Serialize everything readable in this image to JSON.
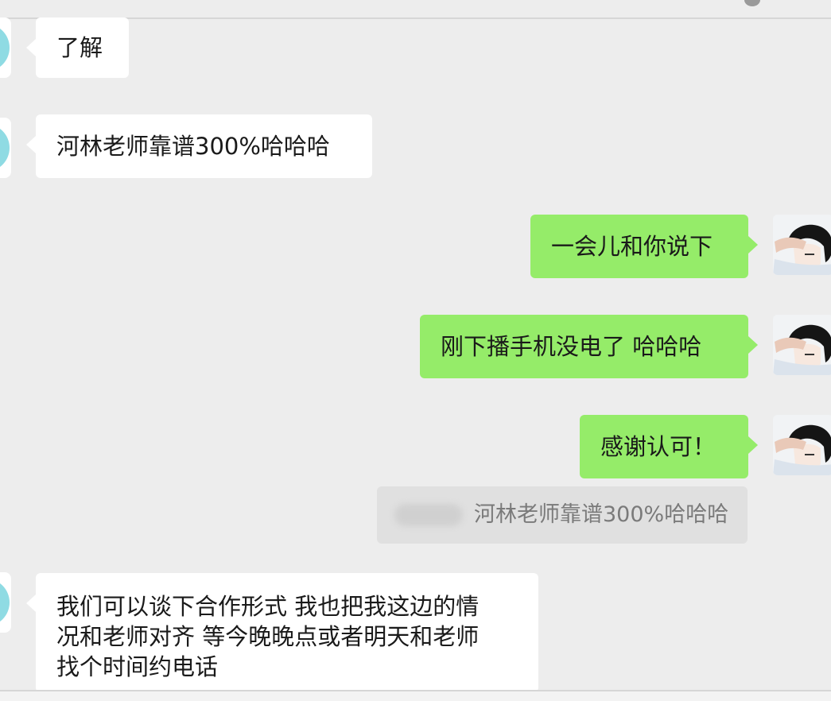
{
  "messages": [
    {
      "sender": "other",
      "text": "了解"
    },
    {
      "sender": "other",
      "text": "河林老师靠谱300%哈哈哈"
    },
    {
      "sender": "me",
      "text": "一会儿和你说下"
    },
    {
      "sender": "me",
      "text": "刚下播手机没电了 哈哈哈"
    },
    {
      "sender": "me",
      "text": "感谢认可！"
    },
    {
      "sender": "other",
      "lines": [
        "我们可以谈下合作形式 我也把我这边的情",
        "况和老师对齐 等今晚晚点或者明天和老师",
        "找个时间约电话"
      ]
    }
  ],
  "quote": {
    "text": "河林老师靠谱300%哈哈哈"
  },
  "colors": {
    "background": "#ededed",
    "incoming_bubble": "#ffffff",
    "outgoing_bubble": "#95ec69",
    "avatar_left": "#8fdbe3",
    "quote_background": "#e0e0e0"
  },
  "icons": {
    "avatar_left": "contact-avatar-icon",
    "avatar_right": "user-anime-avatar-icon"
  }
}
